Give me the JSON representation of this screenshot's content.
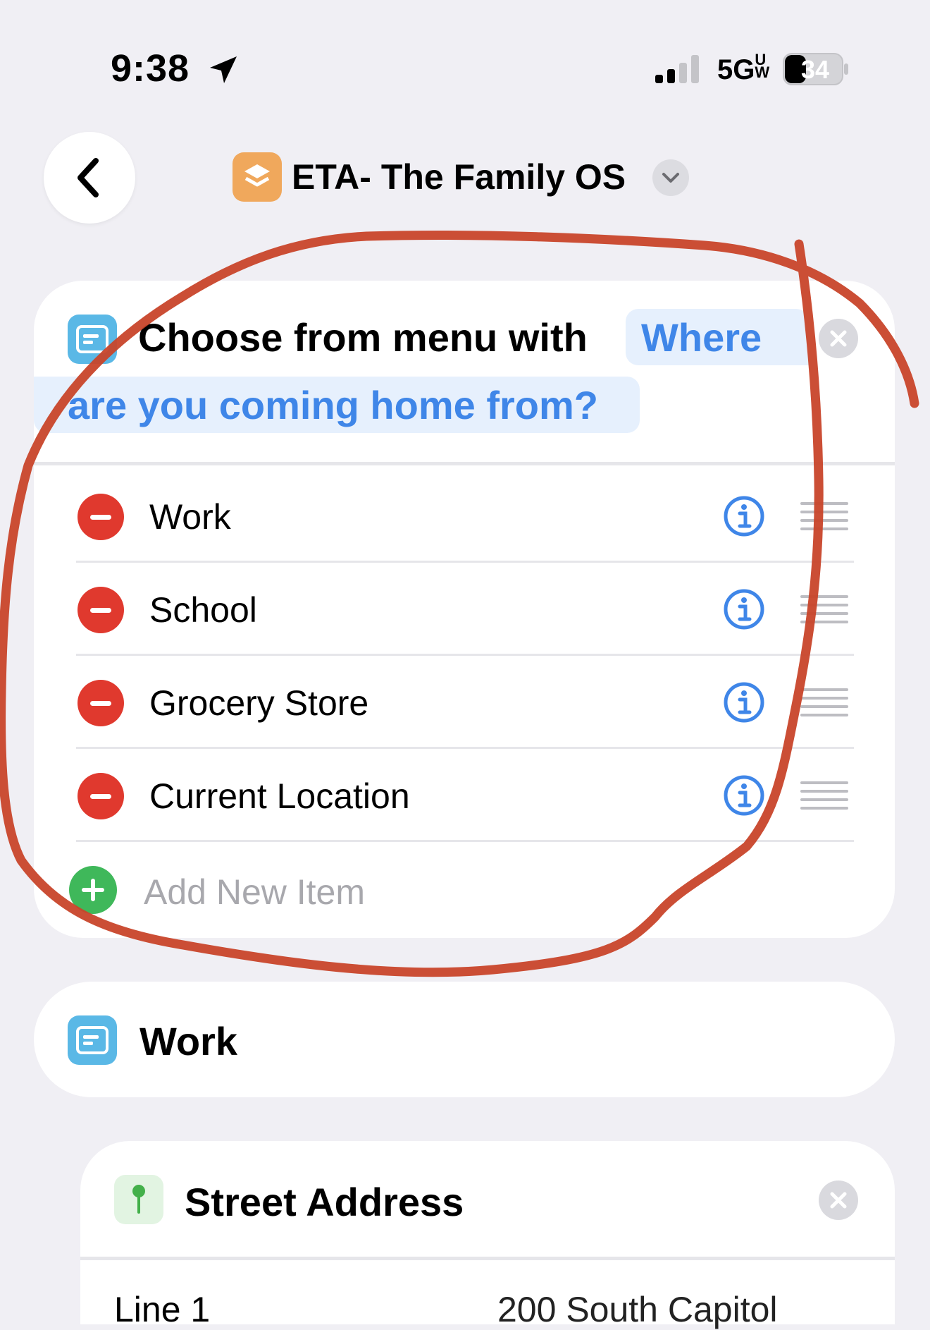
{
  "status_bar": {
    "time": "9:38",
    "network": "5G",
    "network_suffix": "UW",
    "battery": "34",
    "icons": [
      "location-arrow-icon",
      "signal-icon",
      "battery-icon"
    ]
  },
  "nav": {
    "back_icon": "chevron-left-icon",
    "app_icon": "shortcuts-stack-icon",
    "title": "ETA- The Family OS",
    "menu_icon": "chevron-down-icon"
  },
  "menu_action": {
    "icon": "menu-icon",
    "prefix": "Choose from menu with",
    "prompt_line1": "Where",
    "prompt_line2": "are you coming home from?",
    "clear_icon": "close-icon",
    "items": [
      {
        "label": "Work"
      },
      {
        "label": "School"
      },
      {
        "label": "Grocery Store"
      },
      {
        "label": "Current Location"
      }
    ],
    "add_label": "Add New Item"
  },
  "case_block": {
    "icon": "menu-icon",
    "title": "Work"
  },
  "street_address": {
    "icon": "map-pin-icon",
    "title": "Street Address",
    "clear_icon": "close-icon",
    "line1_label": "Line 1",
    "line1_value": "200 South Capitol"
  },
  "colors": {
    "background": "#f0eff4",
    "accent_blue": "#3f86e8",
    "delete_red": "#e0392e",
    "add_green": "#3fb85a",
    "app_orange": "#f0a85c",
    "annotation_red": "#c8442a"
  }
}
